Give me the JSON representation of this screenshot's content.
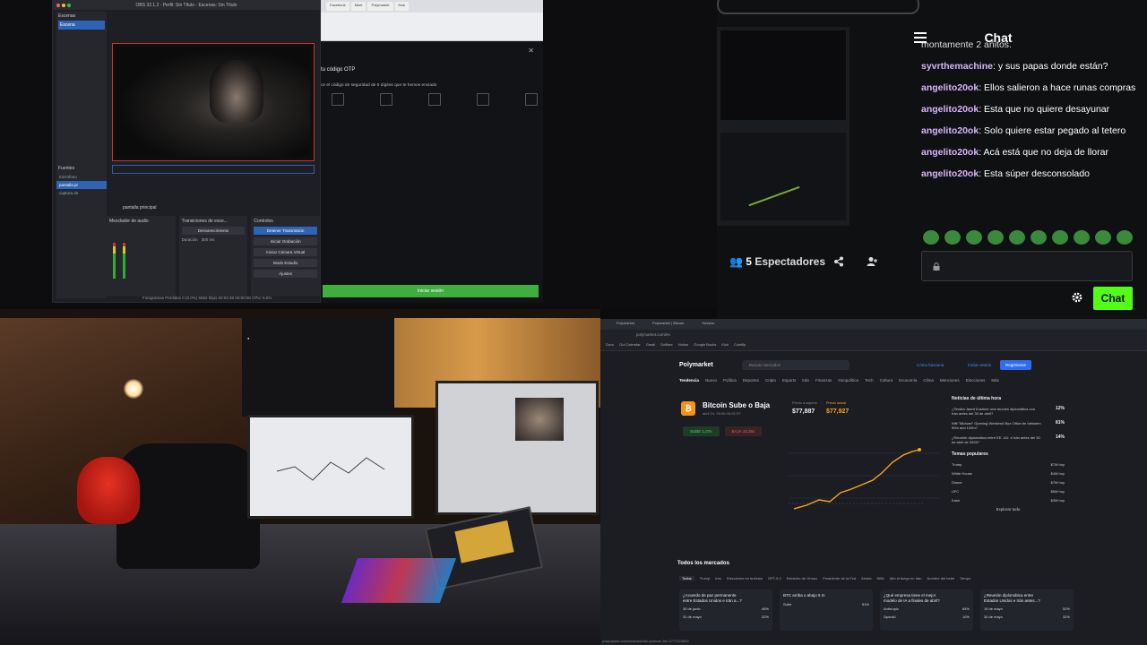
{
  "obs": {
    "title": "OBS 32.1.2 - Perfil: Sin Título - Escenas: Sin Título",
    "scenes_header": "Escenas",
    "scene_selected": "Escena",
    "sources_header": "Fuentes",
    "sources": [
      "microfono",
      "pantalla pr",
      "captura de"
    ],
    "mixer_title": "Mezclador de audio",
    "transitions_title": "Transiciones de esce...",
    "transition_value": "Desvanecimiento",
    "duration_label": "Duración",
    "duration_value": "300 ms",
    "controls_title": "Controles",
    "controls": [
      "Detener Transmisión",
      "Iniciar Grabación",
      "Iniciar Cámara Virtual",
      "Modo Estudio",
      "Ajustes"
    ],
    "screen_label": "pantalla principal",
    "status": "Fotogramas Perdidos 0 (0.0%)   5652 kbps   00:04:38   00:00:00   CPU: 6.8%"
  },
  "browser": {
    "tabs": [
      "Facebook",
      "Meet",
      "Polymarket",
      "Kick"
    ],
    "otp_title": "tu código OTP",
    "otp_desc": "ce el código de seguridad de 6 dígitos que te hemos enviado",
    "login_button": "Iniciar sesión"
  },
  "chat": {
    "title": "Chat",
    "partial_top": "montamente 2 añitos.",
    "messages": [
      {
        "user": "syvrthemachine",
        "text": "y sus papas donde están?"
      },
      {
        "user": "angelito20ok",
        "text": "Ellos salieron a hace runas compras"
      },
      {
        "user": "angelito20ok",
        "text": "Esta que no quiere desayunar"
      },
      {
        "user": "angelito20ok",
        "text": "Solo quiere estar pegado al tetero"
      },
      {
        "user": "angelito20ok",
        "text": "Acá está que no deja de llorar"
      },
      {
        "user": "angelito20ok",
        "text": "Esta súper desconsolado"
      }
    ],
    "viewers_count": "5",
    "viewers_label": "Espectadores",
    "send_button": "Chat",
    "icons": [
      "menu-icon",
      "share-icon",
      "user-add-icon",
      "lock-icon",
      "gear-icon"
    ]
  },
  "polymarket": {
    "tabs": [
      "Polymarket",
      "Polymarket | Bitcoin",
      "Session"
    ],
    "url": "polymarket.com/es",
    "bookmarks": [
      "Docs",
      "Gui Calendar",
      "Gmail",
      "Solflare",
      "Notion",
      "Google Books",
      "Kick",
      "Coinflip"
    ],
    "logo": "Polymarket",
    "search_placeholder": "Buscar mercados",
    "how": "Cómo funciona",
    "login": "Iniciar sesión",
    "register": "Registrarse",
    "categories": [
      "Tendencia",
      "Nuevo",
      "Política",
      "Deportes",
      "Cripto",
      "Esports",
      "Irán",
      "Finanzas",
      "Geopolítica",
      "Tech",
      "Cultura",
      "Economía",
      "Clima",
      "Menciones",
      "Elecciones",
      "Más"
    ],
    "market_title": "Bitcoin Sube o Baja",
    "market_date": "abril 24, 09:00-09:05 ET",
    "price_target_label": "Precio a superar",
    "price_target": "$77,887",
    "price_now_label": "Precio actual",
    "price_now": "$77,927",
    "up_label": "SUBE 1,07x",
    "down_label": "BAJA 15,38x",
    "chart_labels": [
      "$77,900",
      "$77,880",
      "$77,860"
    ],
    "news_title": "Noticias de última hora",
    "news": [
      {
        "text": "¿Tendrá Jared Kushner una reunión diplomática con Irán antes del 30 de abril?",
        "pct": "12%"
      },
      {
        "text": "Will \"Michael\" Opening Weekend Box Office be between 90m and 100m?",
        "pct": "81%"
      },
      {
        "text": "¿Reunión diplomática entre EE. UU. e Irán antes del 30 de abril de 2026?",
        "pct": "14%"
      }
    ],
    "popular_title": "Temas populares",
    "popular": [
      {
        "name": "Trump",
        "vol": "$7M hoy"
      },
      {
        "name": "White House",
        "vol": "$4M hoy"
      },
      {
        "name": "Dinner",
        "vol": "$7M hoy"
      },
      {
        "name": "UFC",
        "vol": "$6M hoy"
      },
      {
        "name": "Kash",
        "vol": "$3M hoy"
      }
    ],
    "explore_all": "Explorar todo",
    "all_markets": "Todos los mercados",
    "all_tabs": [
      "Todos",
      "Trump",
      "Irán",
      "Elecciones en la fiesta",
      "GPT-5.2",
      "Estrecho de Ormuz",
      "Presidente de la Fed",
      "Anoka",
      "NBA",
      "Alto el fuego en Irán",
      "Nombre del bebé",
      "Tempo"
    ],
    "cards": [
      {
        "title": "¿Acuerdo de paz permanente entre Estados Unidos e Irán a...?",
        "l1": "30 de junio",
        "p1": "46%",
        "l2": "31 de mayo",
        "p2": "32%"
      },
      {
        "title": "BTC arriba o abajo 5 m",
        "l1": "Sube",
        "p1": "51%",
        "l2": "",
        "p2": ""
      },
      {
        "title": "¿Qué empresa tiene el mejor modelo de IA a finales de abril?",
        "l1": "Anthropic",
        "p1": "84%",
        "l2": "OpenAI",
        "p2": "10%"
      },
      {
        "title": "¿Reunión diplomática entre Estados Unidos e Irán antes...?",
        "l1": "15 de mayo",
        "p1": "52%",
        "l2": "30 de mayo",
        "p2": "32%"
      }
    ],
    "footer_url": "polymarket.com/es/event/btc-updown-5m-1777024800"
  },
  "colors": {
    "kick_green": "#53fc18",
    "obs_blue": "#2e63b6",
    "chat_user": "#d8b4fe",
    "btc_orange": "#f7931a"
  }
}
